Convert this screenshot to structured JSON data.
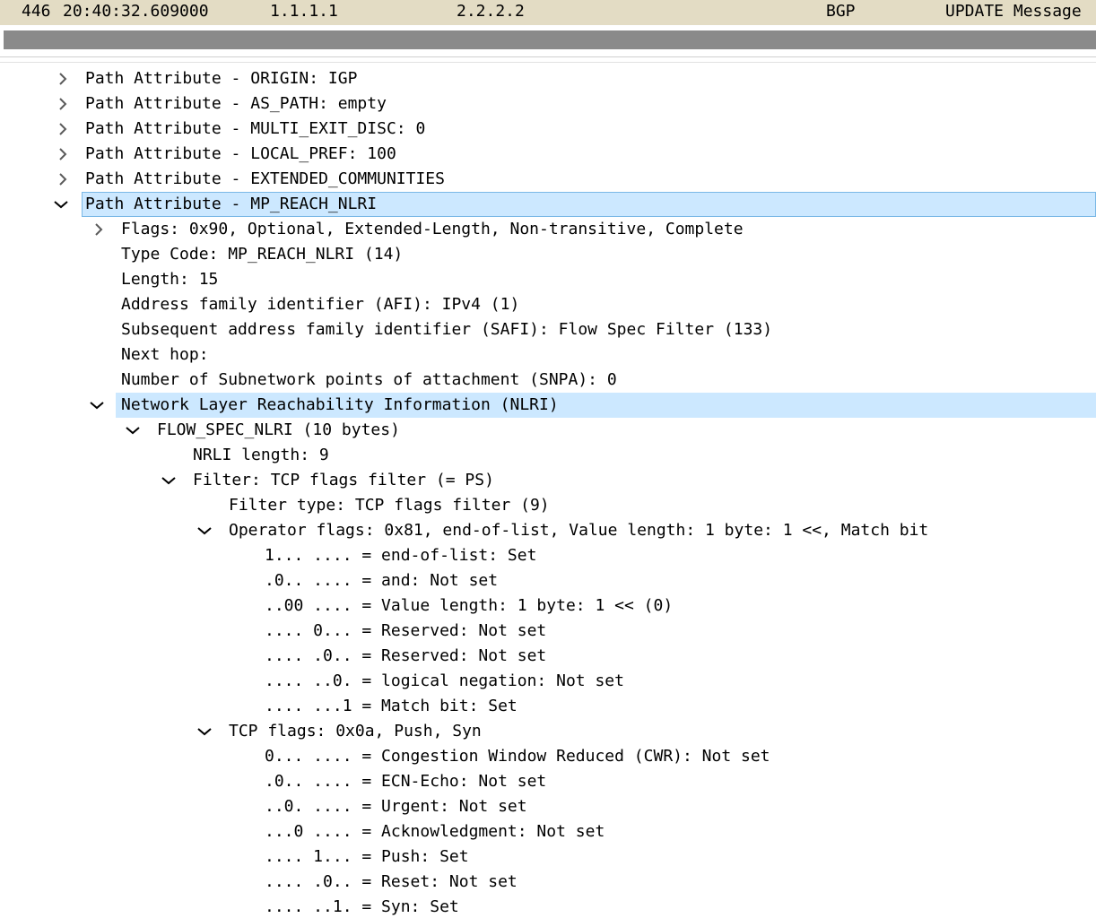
{
  "packet": {
    "no": "446",
    "time": "20:40:32.609000",
    "source": "1.1.1.1",
    "destination": "2.2.2.2",
    "protocol": "BGP",
    "info": "UPDATE Message"
  },
  "tree": [
    {
      "level": 0,
      "caret": "collapsed",
      "text": "Path Attribute - ORIGIN: IGP"
    },
    {
      "level": 0,
      "caret": "collapsed",
      "text": "Path Attribute - AS_PATH: empty"
    },
    {
      "level": 0,
      "caret": "collapsed",
      "text": "Path Attribute - MULTI_EXIT_DISC: 0"
    },
    {
      "level": 0,
      "caret": "collapsed",
      "text": "Path Attribute - LOCAL_PREF: 100"
    },
    {
      "level": 0,
      "caret": "collapsed",
      "text": "Path Attribute - EXTENDED_COMMUNITIES"
    },
    {
      "level": 0,
      "caret": "expanded",
      "text": "Path Attribute - MP_REACH_NLRI",
      "selected": true
    },
    {
      "level": 1,
      "caret": "collapsed",
      "text": "Flags: 0x90, Optional, Extended-Length, Non-transitive, Complete"
    },
    {
      "level": 1,
      "caret": "none",
      "text": "Type Code: MP_REACH_NLRI (14)"
    },
    {
      "level": 1,
      "caret": "none",
      "text": "Length: 15"
    },
    {
      "level": 1,
      "caret": "none",
      "text": "Address family identifier (AFI): IPv4 (1)"
    },
    {
      "level": 1,
      "caret": "none",
      "text": "Subsequent address family identifier (SAFI): Flow Spec Filter (133)"
    },
    {
      "level": 1,
      "caret": "none",
      "text": "Next hop:"
    },
    {
      "level": 1,
      "caret": "none",
      "text": "Number of Subnetwork points of attachment (SNPA): 0"
    },
    {
      "level": 1,
      "caret": "expanded",
      "text": "Network Layer Reachability Information (NLRI)",
      "hover": true
    },
    {
      "level": 2,
      "caret": "expanded",
      "text": "FLOW_SPEC_NLRI (10 bytes)"
    },
    {
      "level": 3,
      "caret": "none",
      "text": "NRLI length: 9"
    },
    {
      "level": 3,
      "caret": "expanded",
      "text": "Filter: TCP flags filter (= PS)"
    },
    {
      "level": 4,
      "caret": "none",
      "text": "Filter type: TCP flags filter (9)"
    },
    {
      "level": 4,
      "caret": "expanded",
      "text": "Operator flags: 0x81, end-of-list, Value length: 1 byte: 1 <<, Match bit"
    },
    {
      "level": 5,
      "caret": "none",
      "text": "1... .... = end-of-list: Set"
    },
    {
      "level": 5,
      "caret": "none",
      "text": ".0.. .... = and: Not set"
    },
    {
      "level": 5,
      "caret": "none",
      "text": "..00 .... = Value length: 1 byte: 1 << (0)"
    },
    {
      "level": 5,
      "caret": "none",
      "text": ".... 0... = Reserved: Not set"
    },
    {
      "level": 5,
      "caret": "none",
      "text": ".... .0.. = Reserved: Not set"
    },
    {
      "level": 5,
      "caret": "none",
      "text": ".... ..0. = logical negation: Not set"
    },
    {
      "level": 5,
      "caret": "none",
      "text": ".... ...1 = Match bit: Set"
    },
    {
      "level": 4,
      "caret": "expanded",
      "text": "TCP flags: 0x0a, Push, Syn"
    },
    {
      "level": 5,
      "caret": "none",
      "text": "0... .... = Congestion Window Reduced (CWR): Not set"
    },
    {
      "level": 5,
      "caret": "none",
      "text": ".0.. .... = ECN-Echo: Not set"
    },
    {
      "level": 5,
      "caret": "none",
      "text": "..0. .... = Urgent: Not set"
    },
    {
      "level": 5,
      "caret": "none",
      "text": "...0 .... = Acknowledgment: Not set"
    },
    {
      "level": 5,
      "caret": "none",
      "text": ".... 1... = Push: Set"
    },
    {
      "level": 5,
      "caret": "none",
      "text": ".... .0.. = Reset: Not set"
    },
    {
      "level": 5,
      "caret": "none",
      "text": ".... ..1. = Syn: Set"
    }
  ],
  "colors": {
    "packet_row_bg": "#e3dcc4",
    "selection_bg": "#cce8ff",
    "selection_border": "#7ab8e6",
    "scrollbar": "#8a8a8a"
  },
  "icons": {
    "collapsed": "chevron-right-icon",
    "expanded": "chevron-down-icon"
  }
}
